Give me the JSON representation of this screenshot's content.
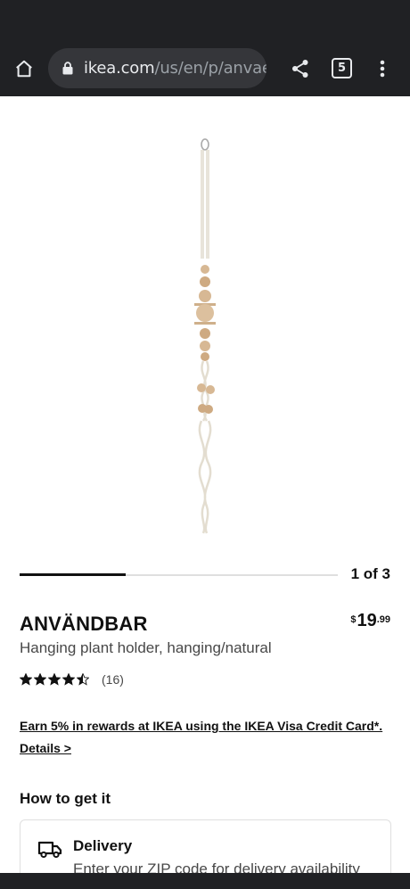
{
  "browser": {
    "url_host": "ikea.com",
    "url_path": "/us/en/p/anvae",
    "tab_count": "5",
    "icons": [
      "home-icon",
      "lock-icon",
      "share-icon",
      "tab-switcher-icon",
      "more-vert-icon"
    ]
  },
  "gallery": {
    "pager_text": "1 of 3",
    "current": 1,
    "total": 3
  },
  "product": {
    "name": "ANVÄNDBAR",
    "description": "Hanging plant holder, hanging/natural",
    "price_currency": "$",
    "price_whole": "19",
    "price_decimal": ".99",
    "rating": 4.5,
    "review_count": "(16)"
  },
  "promo": {
    "text": "Earn 5% in rewards at IKEA using the IKEA Visa Credit Card*. Details >"
  },
  "how_to_get": {
    "title": "How to get it",
    "delivery_title": "Delivery",
    "delivery_text": "Enter your ZIP code for delivery availability"
  },
  "colors": {
    "browser_chrome": "#202124",
    "url_pill": "#35363a",
    "text_primary": "#111111",
    "text_secondary": "#484848"
  }
}
